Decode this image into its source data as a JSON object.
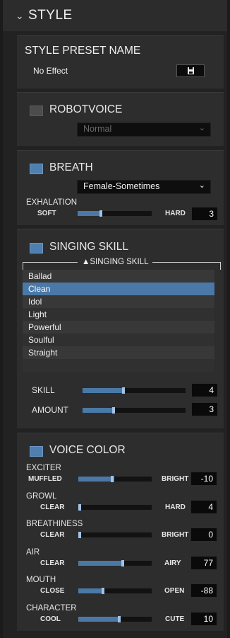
{
  "header": {
    "chevron_icon": "chevron-down-icon",
    "title": "STYLE"
  },
  "preset": {
    "title": "STYLE PRESET NAME",
    "value": "No Effect",
    "save_icon": "save-icon"
  },
  "robotvoice": {
    "title": "ROBOTVOICE",
    "enabled": false,
    "select_value": "Normal"
  },
  "breath": {
    "title": "BREATH",
    "enabled": true,
    "select_value": "Female-Sometimes",
    "param": {
      "label": "EXHALATION",
      "left": "SOFT",
      "right": "HARD",
      "value": "3",
      "level": 0.33
    }
  },
  "singing_skill": {
    "title": "SINGING SKILL",
    "enabled": true,
    "list_header": "▲SINGING SKILL",
    "items": [
      "Ballad",
      "Clean",
      "Idol",
      "Light",
      "Powerful",
      "Soulful",
      "Straight"
    ],
    "selected": "Clean",
    "skill": {
      "label": "SKILL",
      "value": "4",
      "level": 0.4
    },
    "amount": {
      "label": "AMOUNT",
      "value": "3",
      "level": 0.3
    }
  },
  "voice_color": {
    "title": "VOICE COLOR",
    "enabled": true,
    "params": [
      {
        "label": "EXCITER",
        "left": "MUFFLED",
        "right": "BRIGHT",
        "value": "-10",
        "level": 0.45,
        "fill": 0.49
      },
      {
        "label": "GROWL",
        "left": "CLEAR",
        "right": "HARD",
        "value": "4",
        "level": 0.0,
        "fill": 0.04
      },
      {
        "label": "BREATHINESS",
        "left": "CLEAR",
        "right": "BRIGHT",
        "value": "0",
        "level": 0.0,
        "fill": 0.0
      },
      {
        "label": "AIR",
        "left": "CLEAR",
        "right": "AIRY",
        "value": "77",
        "level": 0.6,
        "fill": 0.6
      },
      {
        "label": "MOUTH",
        "left": "CLOSE",
        "right": "OPEN",
        "value": "-88",
        "level": 0.33,
        "fill": 0.33
      },
      {
        "label": "CHARACTER",
        "left": "COOL",
        "right": "CUTE",
        "value": "10",
        "level": 0.55,
        "fill": 0.58
      }
    ]
  }
}
